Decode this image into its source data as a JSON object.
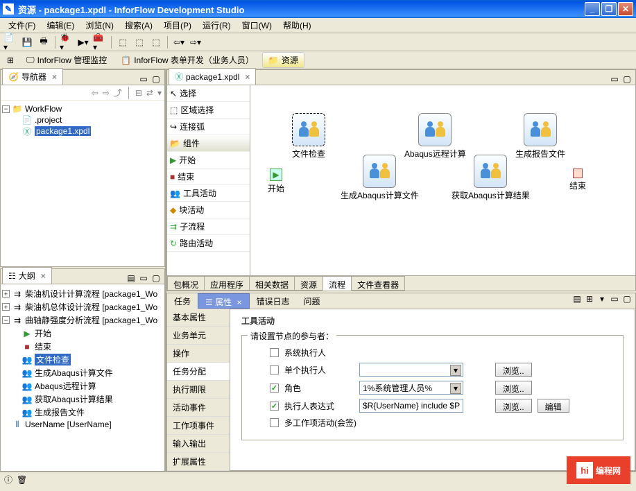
{
  "title": "资源 - package1.xpdl - InforFlow Development Studio",
  "menu": [
    "文件(F)",
    "编辑(E)",
    "浏览(N)",
    "搜索(A)",
    "项目(P)",
    "运行(R)",
    "窗口(W)",
    "帮助(H)"
  ],
  "toolbar2": {
    "tab1": "InforFlow 管理监控",
    "tab2": "InforFlow 表单开发（业务人员）",
    "tab3": "资源"
  },
  "navigator": {
    "title": "导航器",
    "root": "WorkFlow",
    "items": [
      ".project",
      "package1.xpdl"
    ],
    "selected": "package1.xpdl"
  },
  "outline": {
    "title": "大纲",
    "items": [
      {
        "label": "柴油机设计计算流程 [package1_Wo",
        "expanded": false,
        "children": []
      },
      {
        "label": "柴油机总体设计流程 [package1_Wo",
        "expanded": false,
        "children": []
      },
      {
        "label": "曲轴静强度分析流程 [package1_Wo",
        "expanded": true,
        "children": [
          "开始",
          "结束",
          "文件检查",
          "生成Abaqus计算文件",
          "Abaqus远程计算",
          "获取Abaqus计算结果",
          "生成报告文件"
        ]
      },
      {
        "label": "UserName [UserName]",
        "expanded": false,
        "children": []
      }
    ],
    "selected": "文件检查"
  },
  "editor": {
    "tab": "package1.xpdl",
    "palette": {
      "select": "选择",
      "region": "区域选择",
      "connect": "连接弧",
      "category": "组件",
      "start": "开始",
      "end": "结束",
      "tool": "工具活动",
      "block": "块活动",
      "subflow": "子流程",
      "route": "路由活动"
    },
    "nodes": {
      "start": "开始",
      "end": "结束",
      "n1": "文件检查",
      "n2": "生成Abaqus计算文件",
      "n3": "Abaqus远程计算",
      "n4": "获取Abaqus计算结果",
      "n5": "生成报告文件"
    },
    "bottomtabs": [
      "包概况",
      "应用程序",
      "相关数据",
      "资源",
      "流程",
      "文件查看器"
    ],
    "bottomactive": "流程"
  },
  "propsPanel": {
    "tabs": [
      "任务",
      "属性",
      "错误日志",
      "问题"
    ],
    "active": "属性",
    "sidebar": [
      "基本属性",
      "业务单元",
      "操作",
      "任务分配",
      "执行期限",
      "活动事件",
      "工作项事件",
      "输入输出",
      "扩展属性"
    ],
    "sidebar_active": "任务分配",
    "title": "工具活动",
    "legend": "请设置节点的参与者：",
    "rows": {
      "sysexec": "系统执行人",
      "single": "单个执行人",
      "role": "角色",
      "expr": "执行人表达式",
      "multi": "多工作项活动(会签)"
    },
    "values": {
      "role": "1%系统管理人员%",
      "expr": "$R{UserName} include $P{U"
    },
    "browse": "浏览..",
    "edit": "编辑"
  },
  "watermark": "编程网"
}
